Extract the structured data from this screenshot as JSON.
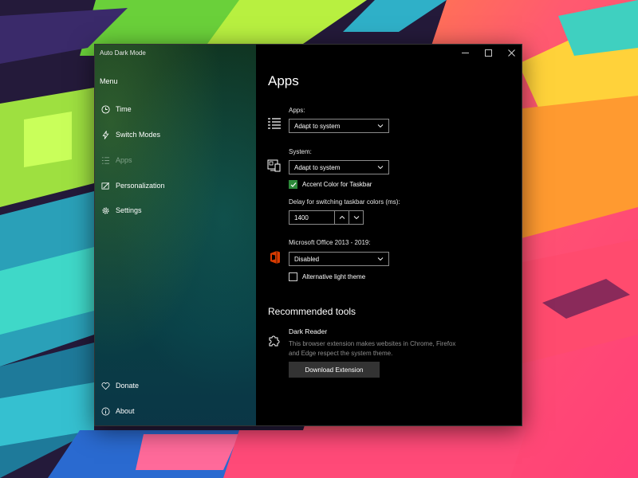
{
  "window": {
    "title": "Auto Dark Mode",
    "controls": {
      "minimize": "—",
      "maximize": "☐",
      "close": "✕"
    }
  },
  "sidebar": {
    "menu_label": "Menu",
    "items": [
      {
        "label": "Time",
        "icon": "clock-icon"
      },
      {
        "label": "Switch Modes",
        "icon": "lightning-icon"
      },
      {
        "label": "Apps",
        "icon": "list-icon",
        "active": true
      },
      {
        "label": "Personalization",
        "icon": "brush-icon"
      },
      {
        "label": "Settings",
        "icon": "gear-icon"
      }
    ],
    "footer_items": [
      {
        "label": "Donate",
        "icon": "heart-icon"
      },
      {
        "label": "About",
        "icon": "info-icon"
      }
    ]
  },
  "main": {
    "title": "Apps",
    "apps": {
      "label": "Apps:",
      "value": "Adapt to system",
      "icon": "apps-list-icon"
    },
    "system": {
      "label": "System:",
      "value": "Adapt to system",
      "icon": "system-icon",
      "accent_checkbox": {
        "label": "Accent Color for Taskbar",
        "checked": true
      },
      "delay_label": "Delay for switching taskbar colors (ms):",
      "delay_value": "1400"
    },
    "office": {
      "label": "Microsoft Office 2013 - 2019:",
      "value": "Disabled",
      "icon": "office-icon",
      "alt_checkbox": {
        "label": "Alternative light theme",
        "checked": false
      }
    },
    "recommended": {
      "title": "Recommended tools",
      "tool_name": "Dark Reader",
      "tool_icon": "puzzle-icon",
      "tool_desc": "This browser extension makes websites in Chrome, Firefox and Edge respect the system theme.",
      "button": "Download Extension"
    }
  },
  "colors": {
    "accent": "#2d8a3a",
    "window_bg": "#000000",
    "muted_text": "#8d8d8d"
  }
}
